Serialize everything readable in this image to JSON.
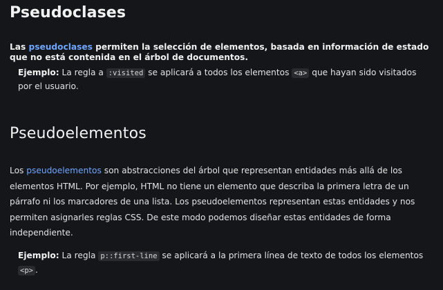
{
  "section1": {
    "title": "Pseudoclases",
    "intro_pre": "Las ",
    "intro_link": "pseudoclases",
    "intro_post": " permiten la selección de elementos, basada en información de estado que no está contenida en el árbol de documentos.",
    "example_label": "Ejemplo:",
    "example_text1": " La regla a ",
    "example_code1": ":visited",
    "example_text2": " se aplicará a todos los elementos ",
    "example_code2": "<a>",
    "example_text3": " que hayan sido visitados por el usuario."
  },
  "section2": {
    "title": "Pseudoelementos",
    "para_pre": "Los ",
    "para_link": "pseudoelementos",
    "para_post": " son abstracciones del árbol que representan entidades más allá de los elementos HTML. Por ejemplo, HTML no tiene un elemento que describa la primera letra de un párrafo ni los marcadores de una lista. Los pseudoelementos representan estas entidades y nos permiten asignarles reglas CSS. De este modo podemos diseñar estas entidades de forma independiente.",
    "example_label": "Ejemplo:",
    "example_text1": " La regla ",
    "example_code1": "p::first-line",
    "example_text2": " se aplicará a la primera línea de texto de todos los elementos ",
    "example_code2": "<p>",
    "example_text3": "."
  }
}
